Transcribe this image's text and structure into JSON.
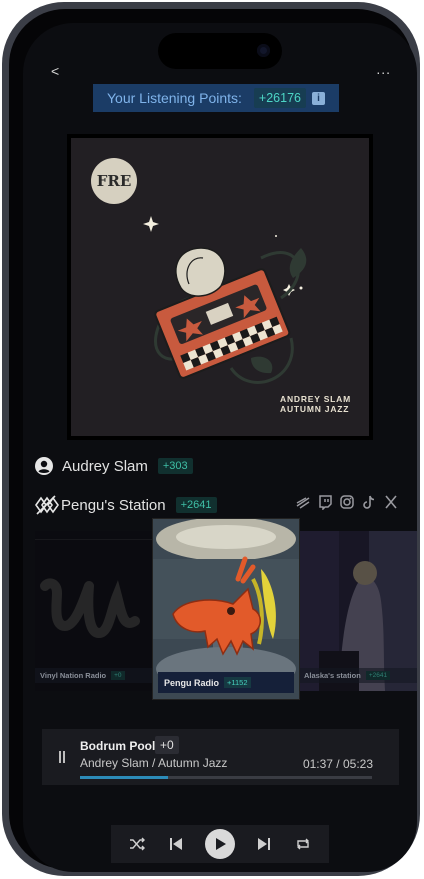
{
  "header": {
    "back_label": "<",
    "more_label": "..."
  },
  "points": {
    "label": "Your Listening Points:",
    "value": "+26176",
    "info_icon": "i"
  },
  "album": {
    "logo_text": "FRE",
    "cover_title_line1": "ANDREY SLAM",
    "cover_title_line2": "AUTUMN JAZZ"
  },
  "artist": {
    "name": "Audrey Slam",
    "points": "+303",
    "icon": "user-circle-icon"
  },
  "station": {
    "name": "Pengu's Station",
    "points": "+2641",
    "icon": "station-logo-icon",
    "socials": [
      "audiomack-icon",
      "twitch-icon",
      "instagram-icon",
      "tiktok-icon",
      "x-icon"
    ]
  },
  "carousel": [
    {
      "name": "Vinyl Nation Radio",
      "points": "+0"
    },
    {
      "name": "Pengu Radio",
      "points": "+1152"
    },
    {
      "name": "Alaska's station",
      "points": "+2641"
    }
  ],
  "player": {
    "title": "Bodrum Pool",
    "points": "+0",
    "subtitle": "Andrey Slam / Autumn Jazz",
    "time": "01:37 / 05:23",
    "progress": 0.3
  },
  "controls": [
    "shuffle-icon",
    "previous-icon",
    "play-icon",
    "next-icon",
    "repeat-icon"
  ],
  "colors": {
    "accent": "#2c8bb8",
    "points_teal": "#4dd6c6",
    "banner": "#1b3c66"
  }
}
